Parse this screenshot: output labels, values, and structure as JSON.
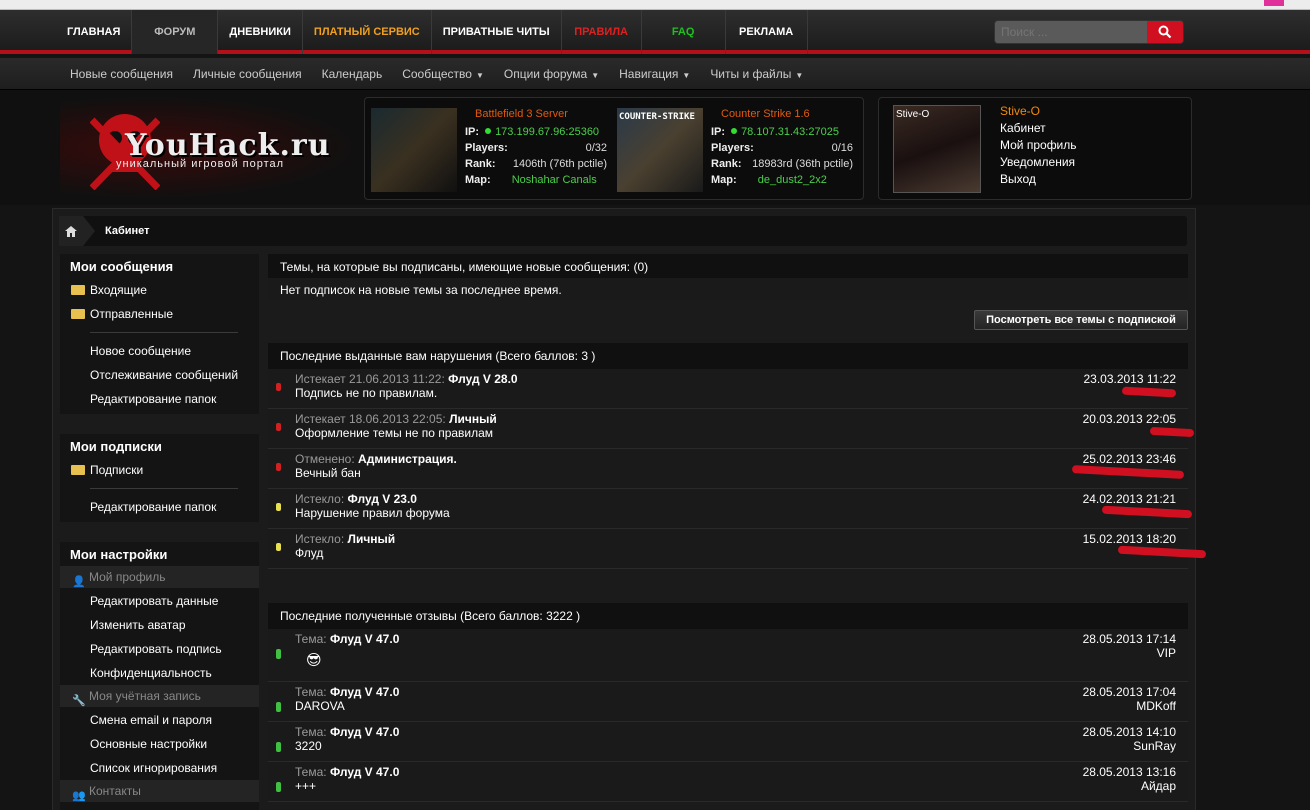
{
  "topnav": {
    "items": [
      "ГЛАВНАЯ",
      "ФОРУМ",
      "ДНЕВНИКИ",
      "ПЛАТНЫЙ СЕРВИС",
      "ПРИВАТНЫЕ ЧИТЫ",
      "ПРАВИЛА",
      "FAQ",
      "РЕКЛАМА"
    ],
    "colors": {
      "paid": "#f0a020",
      "rules": "#e02020",
      "faq": "#20c020"
    },
    "search_placeholder": "Поиск ..."
  },
  "subnav": {
    "items": [
      "Новые сообщения",
      "Личные сообщения",
      "Календарь",
      "Сообщество",
      "Опции форума",
      "Навигация",
      "Читы и файлы"
    ]
  },
  "logo": {
    "title": "YouHack.ru",
    "subtitle": "уникальный игровой портал"
  },
  "servers": [
    {
      "name": "Battlefield 3 Server",
      "ip": "173.199.67.96:25360",
      "players": "0/32",
      "rank": "1406th (76th pctile)",
      "map": "Noshahar Canals"
    },
    {
      "name": "Counter Strike 1.6",
      "ip": "78.107.31.43:27025",
      "players": "0/16",
      "rank": "18983rd (36th pctile)",
      "map": "de_dust2_2x2"
    }
  ],
  "server_labels": {
    "ip": "IP:",
    "players": "Players:",
    "rank": "Rank:",
    "map": "Map:",
    "cs_banner": "COUNTER-STRIKE"
  },
  "user": {
    "name": "Stive-O",
    "avatar_label": "Stive-O",
    "links": [
      "Кабинет",
      "Мой профиль",
      "Уведомления",
      "Выход"
    ]
  },
  "breadcrumb": "Кабинет",
  "sidebar": {
    "messages_title": "Мои сообщения",
    "inbox": "Входящие",
    "sent": "Отправленные",
    "new_message": "Новое сообщение",
    "tracking": "Отслеживание сообщений",
    "edit_folders": "Редактирование папок",
    "subs_title": "Мои подписки",
    "subs": "Подписки",
    "subs_edit_folders": "Редактирование папок",
    "settings_title": "Мои настройки",
    "profile_section": "Мой профиль",
    "edit_data": "Редактировать данные",
    "change_avatar": "Изменить аватар",
    "edit_signature": "Редактировать подпись",
    "privacy": "Конфиденциальность",
    "account_section": "Моя учётная запись",
    "email_password": "Смена email и пароля",
    "main_settings": "Основные настройки",
    "ignore_list": "Список игнорирования",
    "contacts": "Контакты"
  },
  "subscriptions": {
    "title": "Темы, на которые вы подписаны, имеющие новые сообщения: (0)",
    "empty": "Нет подписок на новые темы за последнее время.",
    "button": "Посмотреть все темы с подпиской"
  },
  "infractions": {
    "title": "Последние выданные вам нарушения (Всего баллов: 3 )",
    "rows": [
      {
        "status": "Истекает 21.06.2013 11:22:",
        "type": "Флуд V 28.0",
        "desc": "Подпись не по правилам.",
        "date": "23.03.2013 11:22",
        "led": "#d02020"
      },
      {
        "status": "Истекает 18.06.2013 22:05:",
        "type": "Личный",
        "desc": "Оформление темы не по правилам",
        "date": "20.03.2013 22:05",
        "led": "#d02020"
      },
      {
        "status": "Отменено:",
        "type": "Администрация.",
        "desc": "Вечный бан",
        "date": "25.02.2013 23:46",
        "led": "#d02020"
      },
      {
        "status": "Истекло:",
        "type": "Флуд V 23.0",
        "desc": "Нарушение правил форума",
        "date": "24.02.2013 21:21",
        "led": "#e8e050"
      },
      {
        "status": "Истекло:",
        "type": "Личный",
        "desc": "Флуд",
        "date": "15.02.2013 18:20",
        "led": "#e8e050"
      }
    ]
  },
  "feedback": {
    "title": "Последние полученные отзывы (Всего баллов: 3222 )",
    "label": "Тема:",
    "rows": [
      {
        "topic": "Флуд V 47.0",
        "text": "",
        "date": "28.05.2013 17:14",
        "user": "VIP"
      },
      {
        "topic": "Флуд V 47.0",
        "text": "DAROVA",
        "date": "28.05.2013 17:04",
        "user": "MDKoff"
      },
      {
        "topic": "Флуд V 47.0",
        "text": "3220",
        "date": "28.05.2013 14:10",
        "user": "SunRay"
      },
      {
        "topic": "Флуд V 47.0",
        "text": "+++",
        "date": "28.05.2013 13:16",
        "user": "Айдар"
      }
    ]
  }
}
